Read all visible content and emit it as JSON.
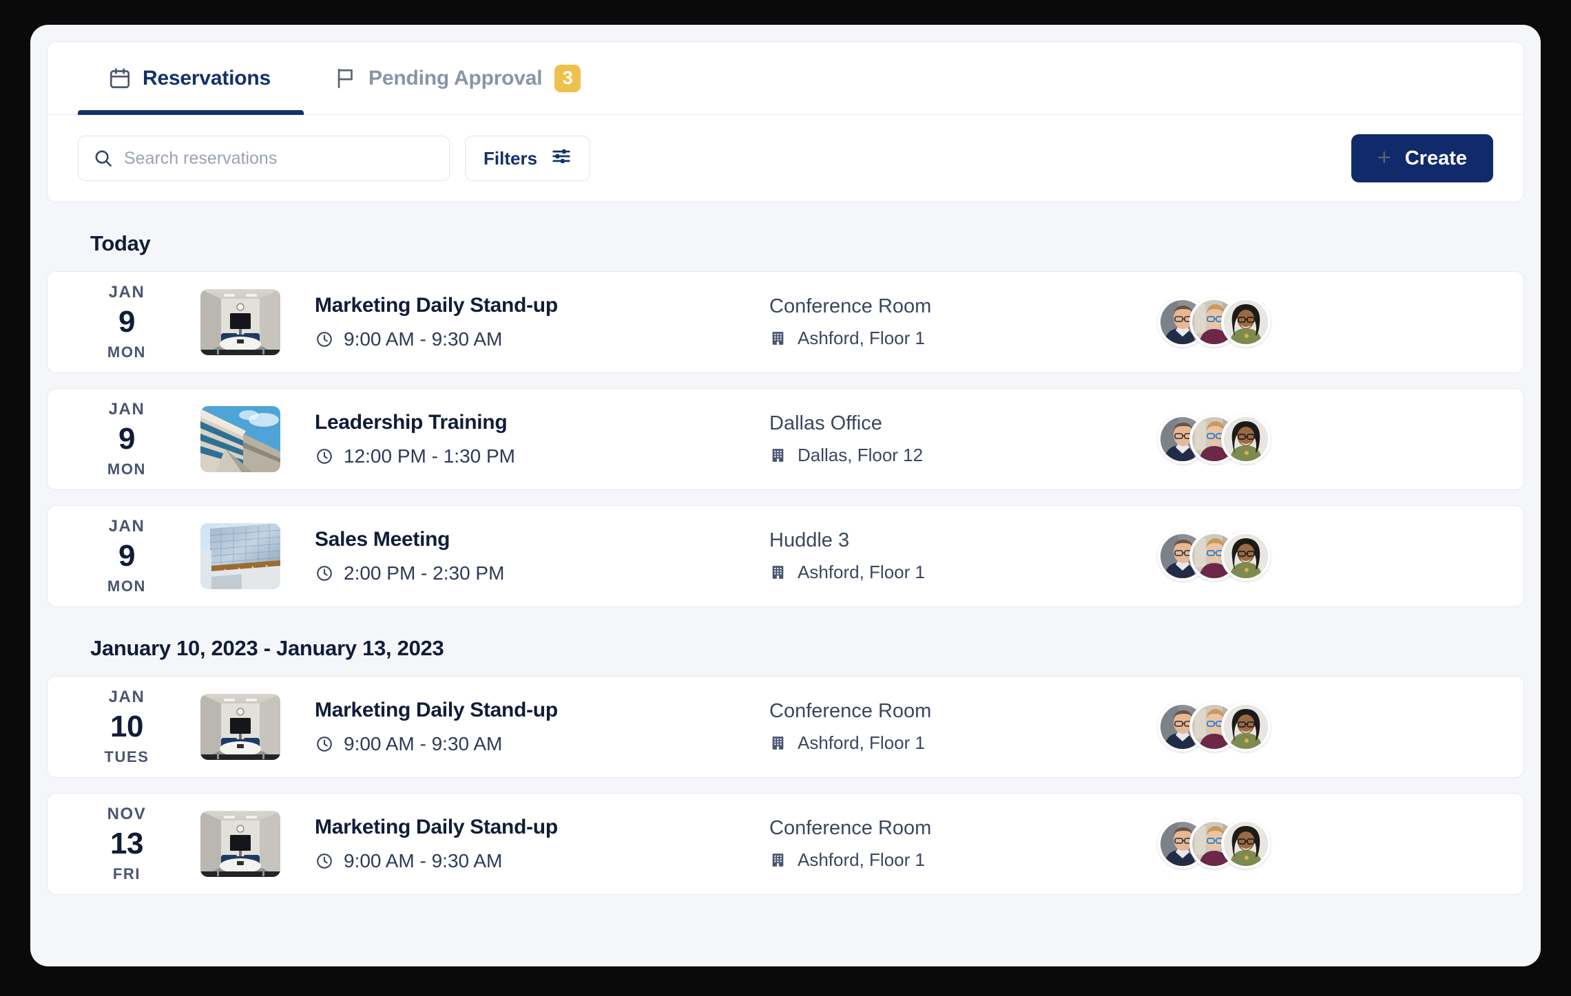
{
  "tabs": [
    {
      "label": "Reservations",
      "icon": "calendar-icon",
      "active": true,
      "badge": null
    },
    {
      "label": "Pending Approval",
      "icon": "flag-icon",
      "active": false,
      "badge": "3"
    }
  ],
  "toolbar": {
    "search_placeholder": "Search reservations",
    "search_value": "",
    "search_icon": "search-icon",
    "filters_label": "Filters",
    "filters_icon": "sliders-icon",
    "create_label": "Create",
    "create_icon": "plus-icon"
  },
  "colors": {
    "accent": "#102a6b",
    "badge": "#eec14c",
    "page_background": "#f5f6fa",
    "row_background": "#ffffff",
    "text_dark": "#111c38",
    "text_muted": "#8b94a7"
  },
  "sections": [
    {
      "title": "Today",
      "rows": [
        {
          "month": "JAN",
          "day": "9",
          "weekday": "MON",
          "thumb": "conference-room-photo",
          "title": "Marketing Daily Stand-up",
          "time": "9:00 AM - 9:30 AM",
          "time_icon": "clock-icon",
          "place": "Conference Room",
          "building_icon": "building-icon",
          "building": "Ashford, Floor 1",
          "attendees": 3
        },
        {
          "month": "JAN",
          "day": "9",
          "weekday": "MON",
          "thumb": "office-building-photo",
          "title": "Leadership Training",
          "time": "12:00 PM - 1:30 PM",
          "time_icon": "clock-icon",
          "place": "Dallas Office",
          "building_icon": "building-icon",
          "building": "Dallas, Floor 12",
          "attendees": 3
        },
        {
          "month": "JAN",
          "day": "9",
          "weekday": "MON",
          "thumb": "glass-tower-photo",
          "title": "Sales Meeting",
          "time": "2:00 PM - 2:30 PM",
          "time_icon": "clock-icon",
          "place": "Huddle 3",
          "building_icon": "building-icon",
          "building": "Ashford, Floor 1",
          "attendees": 3
        }
      ]
    },
    {
      "title": "January 10, 2023 - January 13, 2023",
      "rows": [
        {
          "month": "JAN",
          "day": "10",
          "weekday": "TUES",
          "thumb": "conference-room-photo",
          "title": "Marketing Daily Stand-up",
          "time": "9:00 AM - 9:30 AM",
          "time_icon": "clock-icon",
          "place": "Conference Room",
          "building_icon": "building-icon",
          "building": "Ashford, Floor 1",
          "attendees": 3
        },
        {
          "month": "NOV",
          "day": "13",
          "weekday": "FRI",
          "thumb": "conference-room-photo",
          "title": "Marketing Daily Stand-up",
          "time": "9:00 AM - 9:30 AM",
          "time_icon": "clock-icon",
          "place": "Conference Room",
          "building_icon": "building-icon",
          "building": "Ashford, Floor 1",
          "attendees": 3
        }
      ]
    }
  ]
}
